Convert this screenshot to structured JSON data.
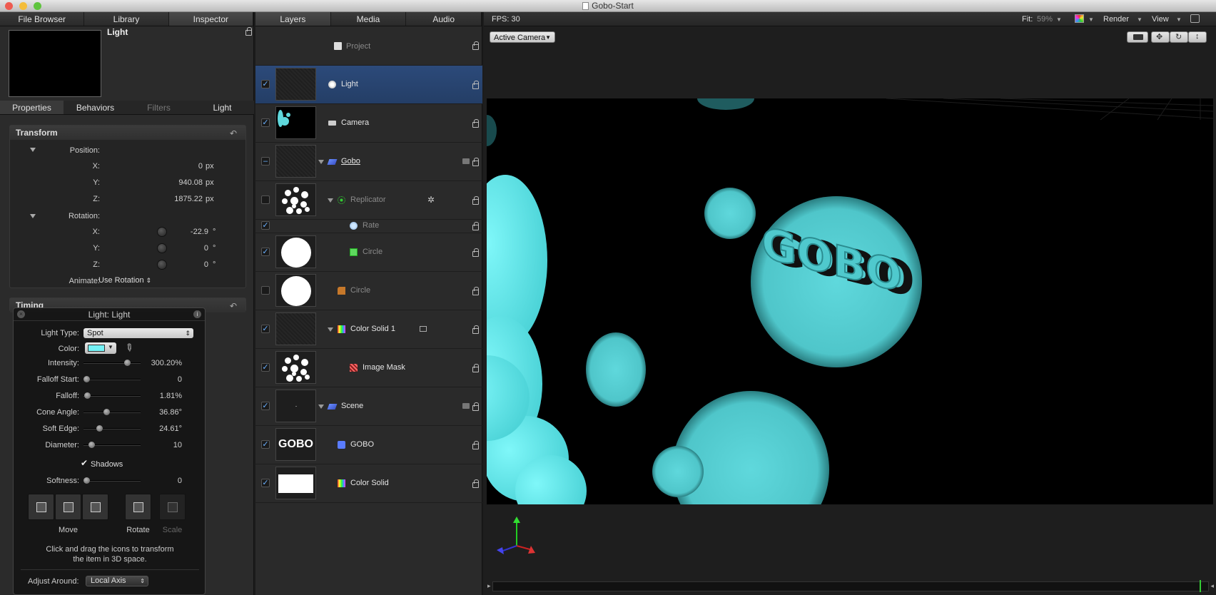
{
  "window": {
    "title": "Gobo-Start"
  },
  "left_panel": {
    "tabs": [
      "File Browser",
      "Library",
      "Inspector"
    ],
    "preview_title": "Light",
    "sub_tabs": [
      "Properties",
      "Behaviors",
      "Filters",
      "Light"
    ],
    "transform": {
      "title": "Transform",
      "position_label": "Position:",
      "position": [
        {
          "axis": "X:",
          "value": "0",
          "unit": "px"
        },
        {
          "axis": "Y:",
          "value": "940.08",
          "unit": "px"
        },
        {
          "axis": "Z:",
          "value": "1875.22",
          "unit": "px"
        }
      ],
      "rotation_label": "Rotation:",
      "rotation": [
        {
          "axis": "X:",
          "value": "-22.9",
          "unit": "°"
        },
        {
          "axis": "Y:",
          "value": "0",
          "unit": "°"
        },
        {
          "axis": "Z:",
          "value": "0",
          "unit": "°"
        }
      ],
      "animate_label": "Animate:",
      "animate_value": "Use Rotation"
    },
    "timing": {
      "title": "Timing"
    }
  },
  "hud": {
    "title": "Light: Light",
    "light_type_label": "Light Type:",
    "light_type_value": "Spot",
    "color_label": "Color:",
    "color_swatch": "#74f2f5",
    "sliders": [
      {
        "label": "Intensity:",
        "value": "300.20%",
        "level": 0.8
      },
      {
        "label": "Falloff Start:",
        "value": "0",
        "level": 0.0
      },
      {
        "label": "Falloff:",
        "value": "1.81%",
        "level": 0.02
      },
      {
        "label": "Cone Angle:",
        "value": "36.86°",
        "level": 0.4
      },
      {
        "label": "Soft Edge:",
        "value": "24.61°",
        "level": 0.25
      },
      {
        "label": "Diameter:",
        "value": "10",
        "level": 0.1
      }
    ],
    "shadows_label": "Shadows",
    "softness": {
      "label": "Softness:",
      "value": "0",
      "level": 0.0
    },
    "move_label": "Move",
    "rotate_label": "Rotate",
    "scale_label": "Scale",
    "help_line1": "Click and drag the icons to transform",
    "help_line2": "the item in 3D space.",
    "adjust_label": "Adjust Around:",
    "adjust_value": "Local Axis"
  },
  "layers_panel": {
    "tabs": [
      "Layers",
      "Media",
      "Audio"
    ],
    "project_label": "Project",
    "rows": [
      {
        "name": "Light",
        "checked": true,
        "selected": true
      },
      {
        "name": "Camera",
        "checked": true
      },
      {
        "name": "Gobo",
        "checked": "mixed"
      },
      {
        "name": "Replicator",
        "checked": false
      },
      {
        "name": "Rate",
        "checked": true
      },
      {
        "name": "Circle",
        "checked": true
      },
      {
        "name": "Circle",
        "checked": false
      },
      {
        "name": "Color Solid 1",
        "checked": true
      },
      {
        "name": "Image Mask",
        "checked": true
      },
      {
        "name": "Scene",
        "checked": true
      },
      {
        "name": "GOBO",
        "checked": true
      },
      {
        "name": "Color Solid",
        "checked": true
      }
    ],
    "gobo_thumb_text": "GOBO"
  },
  "canvas": {
    "fps_label": "FPS: 30",
    "fit_label": "Fit:",
    "fit_value": "59%",
    "render_label": "Render",
    "view_label": "View",
    "camera_popup": "Active Camera",
    "scene_text": "GOBO",
    "light_color": "#5fd8dc"
  }
}
